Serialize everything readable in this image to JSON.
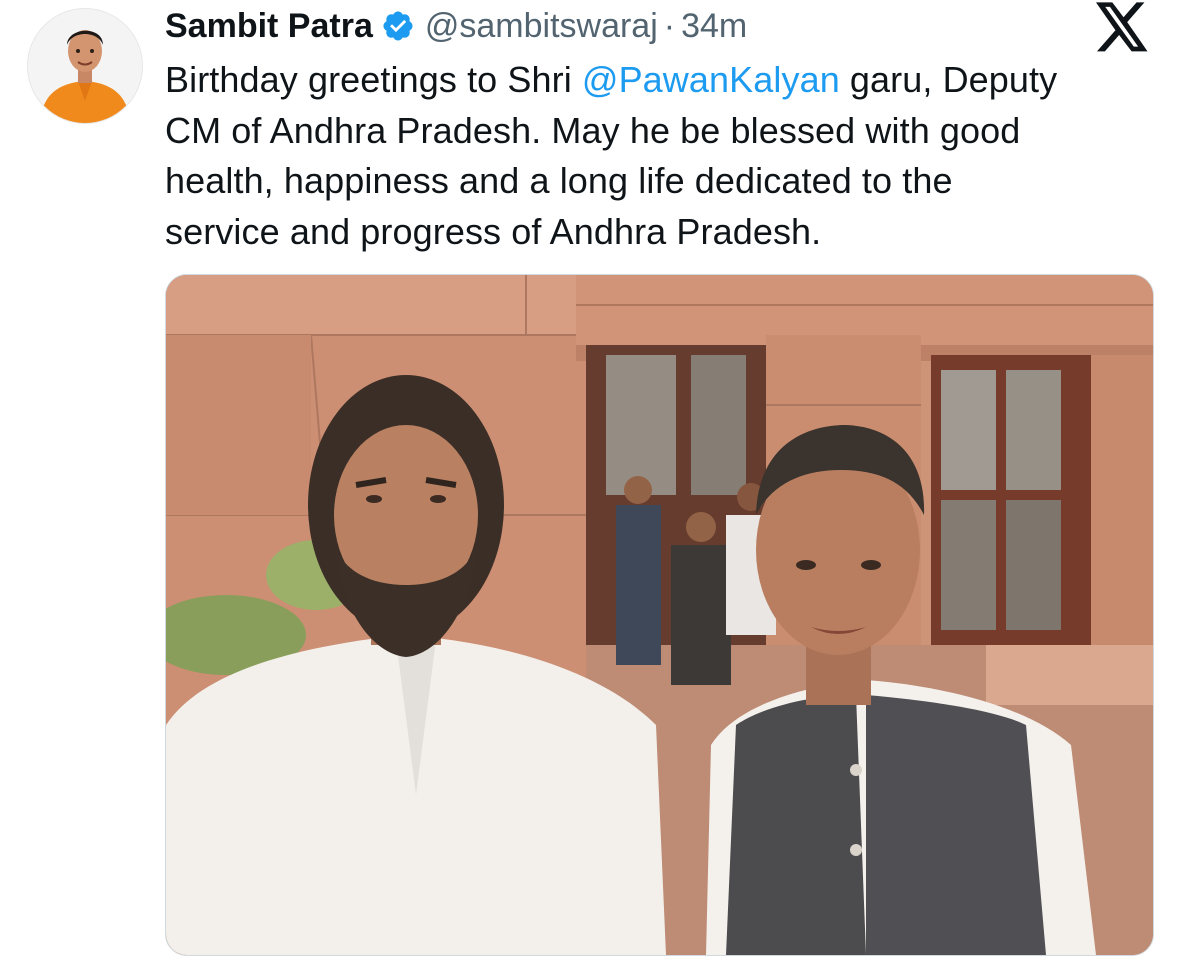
{
  "tweet": {
    "author_name": "Sambit Patra",
    "handle": "@sambitswaraj",
    "separator": "·",
    "time": "34m",
    "text_lines": [
      {
        "pre": "Birthday greetings to Shri ",
        "mention": "@PawanKalyan",
        "post": " garu, Deputy"
      },
      {
        "text": "CM of Andhra Pradesh. May he be blessed with good"
      },
      {
        "text": "health, happiness and a long life dedicated to the"
      },
      {
        "text": "service and progress of Andhra Pradesh."
      }
    ]
  },
  "icons": {
    "verified": "verified-badge-icon",
    "platform_logo": "x-logo-icon",
    "accent": "#1d9bf0",
    "muted_text": "#536471"
  }
}
